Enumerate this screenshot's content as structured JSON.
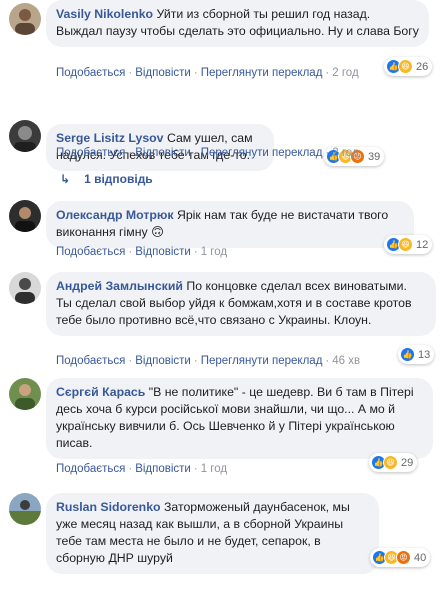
{
  "actions": {
    "like": "Подобається",
    "reply": "Відповісти",
    "see_translation": "Переглянути переклад",
    "separator": "·"
  },
  "comments": [
    {
      "author": "Vasily Nikolenko",
      "text": "Уйти из сборной ты решил год назад. Выждал паузу чтобы сделать это официально. Ну и слава Богу",
      "reactions": [
        "like",
        "haha"
      ],
      "reaction_count": "26",
      "time": "2 год"
    },
    {
      "author": "Serge Lisitz Lysov",
      "text": "Сам ушел, сам надулся. Успехов тебе там где-то.",
      "reactions": [
        "like",
        "haha",
        "angry"
      ],
      "reaction_count": "39",
      "time": "2 год",
      "replies_label": "1 відповідь"
    },
    {
      "author": "Олександр Мотрюк",
      "text": "Ярік нам так буде не вистачати твого виконання гімну 🙃",
      "reactions": [
        "like",
        "haha"
      ],
      "reaction_count": "12",
      "time": "1 год"
    },
    {
      "author": "Андрей Замлынский",
      "text": "По концовке сделал всех виноватыми. Ты сделал свой выбор уйдя к бомжам,хотя и в составе кротов тебе было противно всё,что связано с Украины. Клоун.",
      "reactions": [
        "like"
      ],
      "reaction_count": "13",
      "time": "46 хв"
    },
    {
      "author": "Сєргєй Карась",
      "text": "\"В не политике\" - це шедевр. Ви б там в Пітері десь хоча б курси російської мови знайшли, чи що... А мо й українську вивчили б. Ось Шевченко й у Пітері українською писав.",
      "reactions": [
        "like",
        "haha"
      ],
      "reaction_count": "29",
      "time": "1 год"
    },
    {
      "author": "Ruslan Sidorenko",
      "text": "Заторможеный даунбасенок, мы уже месяц назад как вышли, а в сборной Украины тебе там места не было и не будет, сепарок, в сборную ДНР шуруй",
      "reactions": [
        "like",
        "haha",
        "angry"
      ],
      "reaction_count": "40"
    }
  ]
}
